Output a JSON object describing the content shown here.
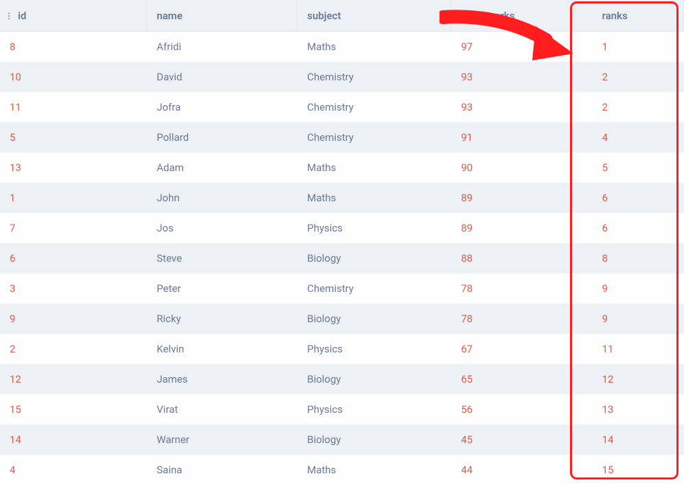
{
  "table": {
    "columns": [
      {
        "key": "id",
        "label": "id"
      },
      {
        "key": "name",
        "label": "name"
      },
      {
        "key": "subject",
        "label": "subject"
      },
      {
        "key": "final_marks",
        "label": "final_marks"
      },
      {
        "key": "ranks",
        "label": "ranks"
      }
    ],
    "rows": [
      {
        "id": "8",
        "name": "Afridi",
        "subject": "Maths",
        "final_marks": "97",
        "ranks": "1"
      },
      {
        "id": "10",
        "name": "David",
        "subject": "Chemistry",
        "final_marks": "93",
        "ranks": "2"
      },
      {
        "id": "11",
        "name": "Jofra",
        "subject": "Chemistry",
        "final_marks": "93",
        "ranks": "2"
      },
      {
        "id": "5",
        "name": "Pollard",
        "subject": "Chemistry",
        "final_marks": "91",
        "ranks": "4"
      },
      {
        "id": "13",
        "name": "Adam",
        "subject": "Maths",
        "final_marks": "90",
        "ranks": "5"
      },
      {
        "id": "1",
        "name": "John",
        "subject": "Maths",
        "final_marks": "89",
        "ranks": "6"
      },
      {
        "id": "7",
        "name": "Jos",
        "subject": "Physics",
        "final_marks": "89",
        "ranks": "6"
      },
      {
        "id": "6",
        "name": "Steve",
        "subject": "Biology",
        "final_marks": "88",
        "ranks": "8"
      },
      {
        "id": "3",
        "name": "Peter",
        "subject": "Chemistry",
        "final_marks": "78",
        "ranks": "9"
      },
      {
        "id": "9",
        "name": "Ricky",
        "subject": "Biology",
        "final_marks": "78",
        "ranks": "9"
      },
      {
        "id": "2",
        "name": "Kelvin",
        "subject": "Physics",
        "final_marks": "67",
        "ranks": "11"
      },
      {
        "id": "12",
        "name": "James",
        "subject": "Biology",
        "final_marks": "65",
        "ranks": "12"
      },
      {
        "id": "15",
        "name": "Virat",
        "subject": "Physics",
        "final_marks": "56",
        "ranks": "13"
      },
      {
        "id": "14",
        "name": "Warner",
        "subject": "Biology",
        "final_marks": "45",
        "ranks": "14"
      },
      {
        "id": "4",
        "name": "Saina",
        "subject": "Maths",
        "final_marks": "44",
        "ranks": "15"
      }
    ]
  },
  "annotations": {
    "highlight_column": "ranks",
    "arrow_color": "#ff1d1d"
  }
}
